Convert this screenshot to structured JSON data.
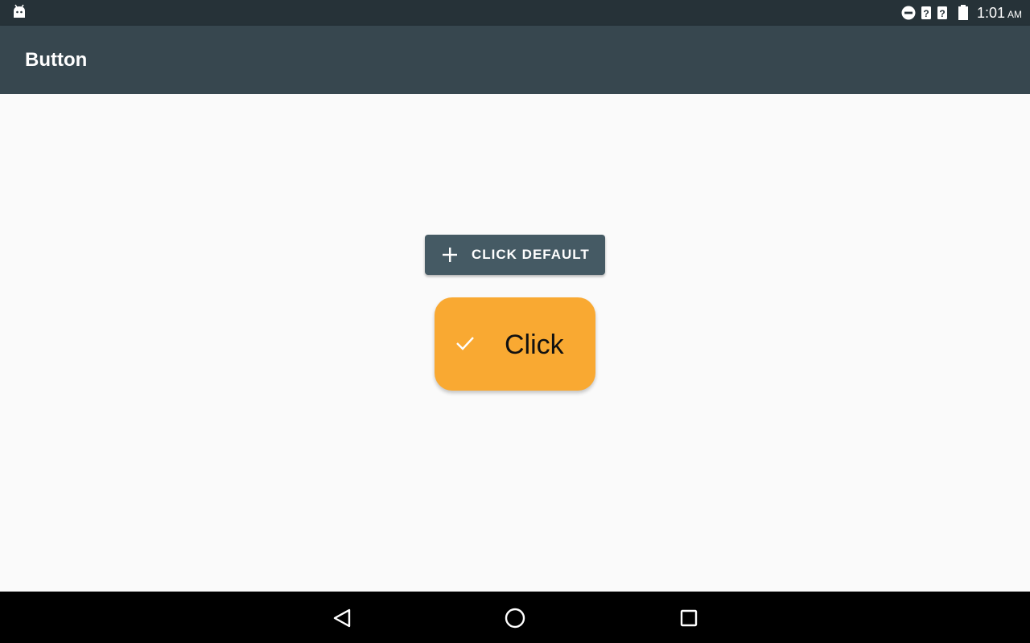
{
  "status_bar": {
    "time": "1:01",
    "ampm": "AM",
    "icons": [
      "android-debug-icon",
      "do-not-disturb-icon",
      "unknown-signal-icon",
      "unknown-signal-icon",
      "battery-icon"
    ]
  },
  "app_bar": {
    "title": "Button"
  },
  "buttons": {
    "default_label": "CLICK DEFAULT",
    "default_icon": "plus-icon",
    "custom_label": "Click",
    "custom_icon": "check-icon"
  },
  "nav_bar": {
    "items": [
      "back-icon",
      "home-icon",
      "recents-icon"
    ]
  },
  "colors": {
    "status_bar": "#263238",
    "app_bar": "#37474f",
    "default_button": "#455a64",
    "custom_button": "#f9a932",
    "background": "#fafafa"
  }
}
